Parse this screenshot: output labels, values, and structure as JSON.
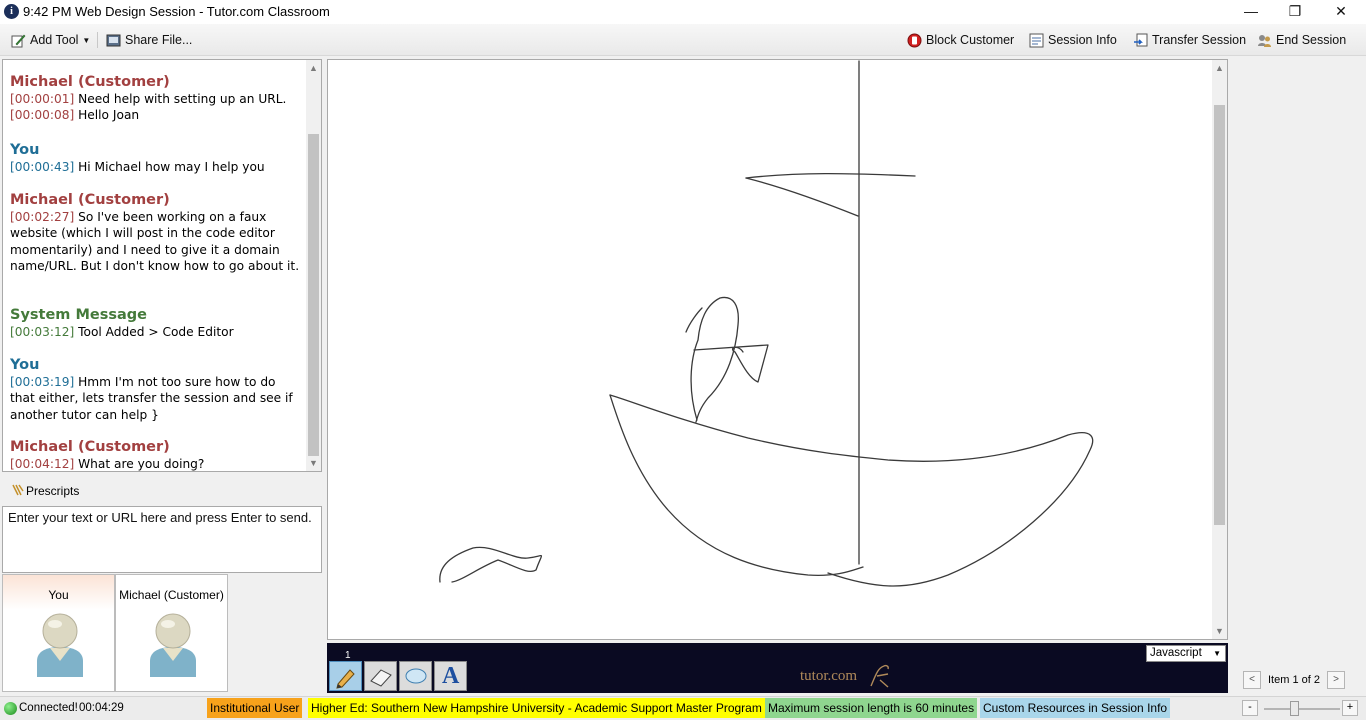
{
  "window": {
    "title": "9:42 PM Web Design Session - Tutor.com Classroom",
    "app_icon": "info-icon",
    "min_label": "—",
    "max_label": "❐",
    "close_label": "✕"
  },
  "toolbar": {
    "add_tool": "Add Tool",
    "share_file": "Share File...",
    "block_customer": "Block Customer",
    "session_info": "Session Info",
    "transfer_session": "Transfer Session",
    "end_session": "End Session"
  },
  "chat": {
    "messages": [
      {
        "sender": "Michael (Customer)",
        "lines": [
          {
            "ts": "[00:00:01]",
            "text": "Need help with setting up an URL."
          },
          {
            "ts": "[00:00:08]",
            "text": "Hello Joan"
          }
        ]
      },
      {
        "sender": "You",
        "lines": [
          {
            "ts": "[00:00:43]",
            "text": "Hi Michael how may I help you"
          }
        ]
      },
      {
        "sender": "Michael (Customer)",
        "lines": [
          {
            "ts": "[00:02:27]",
            "text": "So I've been working on a faux website (which I will post in the code editor momentarily) and I need to give it a domain name/URL. But I don't know how to go about it."
          }
        ]
      },
      {
        "sender": "System Message",
        "lines": [
          {
            "ts": "[00:03:12]",
            "text": "Tool Added > Code Editor"
          }
        ]
      },
      {
        "sender": "You",
        "lines": [
          {
            "ts": "[00:03:19]",
            "text": "Hmm I'm not too sure how to do that either, lets transfer the session and see if another tutor can help }"
          }
        ]
      },
      {
        "sender": "Michael (Customer)",
        "lines": [
          {
            "ts": "[00:04:12]",
            "text": "What are you doing?"
          }
        ]
      }
    ],
    "prescripts_label": "Prescripts",
    "input_placeholder": "Enter your text or URL here and press Enter to send."
  },
  "participants": [
    {
      "name": "You"
    },
    {
      "name": "Michael (Customer)"
    }
  ],
  "whiteboard": {
    "page_number": "1",
    "language": "Javascript",
    "brand": "tutor.com",
    "tools": [
      "pencil-tool",
      "eraser-tool",
      "ellipse-tool",
      "text-tool"
    ],
    "text_tool_glyph": "A",
    "item_label": "Item 1 of 2",
    "prev_label": "<",
    "next_label": ">"
  },
  "status": {
    "connection": "Connected!",
    "elapsed": "00:04:29",
    "badges": [
      {
        "text": "Institutional User",
        "color": "#f7a21b"
      },
      {
        "text": "Higher Ed: Southern New Hampshire University - Academic Support Master Program",
        "color": "#ffff00"
      },
      {
        "text": "Maximum session length is 60 minutes",
        "color": "#8fd68f"
      },
      {
        "text": "Custom Resources in Session Info",
        "color": "#a9d6ea"
      }
    ],
    "zoom_minus": "-",
    "zoom_plus": "+"
  }
}
